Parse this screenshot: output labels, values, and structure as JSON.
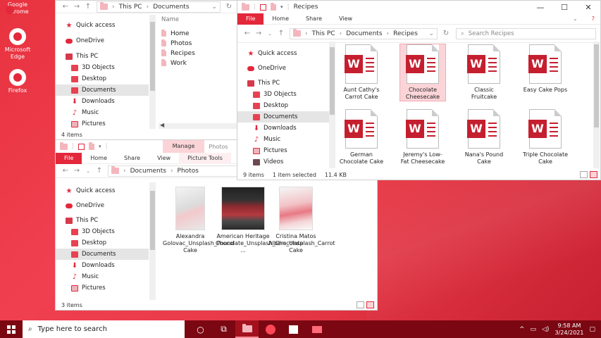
{
  "desktop": {
    "icons": [
      {
        "label": "Google Chrome"
      },
      {
        "label": "Microsoft Edge"
      },
      {
        "label": "Firefox"
      }
    ]
  },
  "docs_window": {
    "path": [
      "This PC",
      "Documents"
    ],
    "column_header": "Name",
    "folders": [
      "Home",
      "Photos",
      "Recipes",
      "Work"
    ],
    "status": "4 items",
    "tree": [
      "Quick access",
      "OneDrive",
      "This PC",
      "3D Objects",
      "Desktop",
      "Documents",
      "Downloads",
      "Music",
      "Pictures"
    ]
  },
  "recipes_window": {
    "title": "Recipes",
    "ribbon": [
      "File",
      "Home",
      "Share",
      "View"
    ],
    "path": [
      "This PC",
      "Documents",
      "Recipes"
    ],
    "search_placeholder": "Search Recipes",
    "tree": [
      "Quick access",
      "OneDrive",
      "This PC",
      "3D Objects",
      "Desktop",
      "Documents",
      "Downloads",
      "Music",
      "Pictures",
      "Videos"
    ],
    "files": [
      "Aunt Cathy's Carrot Cake",
      "Chocolate Cheesecake",
      "Classic Fruitcake",
      "Easy Cake Pops",
      "German Chocolate Cake",
      "Jeremy's Low-Fat Cheesecake",
      "Nana's Pound Cake",
      "Triple Chocolate Cake"
    ],
    "status_count": "9 items",
    "status_selected": "1 item selected",
    "status_size": "11.4 KB"
  },
  "photos_window": {
    "title": "Photos",
    "manage": "Manage",
    "ribbon": [
      "File",
      "Home",
      "Share",
      "View",
      "Picture Tools"
    ],
    "path": [
      "Documents",
      "Photos"
    ],
    "tree": [
      "Quick access",
      "OneDrive",
      "This PC",
      "3D Objects",
      "Desktop",
      "Documents",
      "Downloads",
      "Music",
      "Pictures"
    ],
    "files": [
      "Alexandra Golovac_Unsplash_Pound Cake",
      "American Heritage Chocolate_Unsplash_Chocolate ...",
      "Cristina Matos Albers_Unsplash_Carrot Cake"
    ],
    "status": "3 items"
  },
  "taskbar": {
    "search_placeholder": "Type here to search",
    "time": "9:58 AM",
    "date": "3/24/2021"
  },
  "colors": {
    "accent": "#e2283a",
    "taskbar": "#7b0712",
    "word_icon": "#c51f2f"
  }
}
